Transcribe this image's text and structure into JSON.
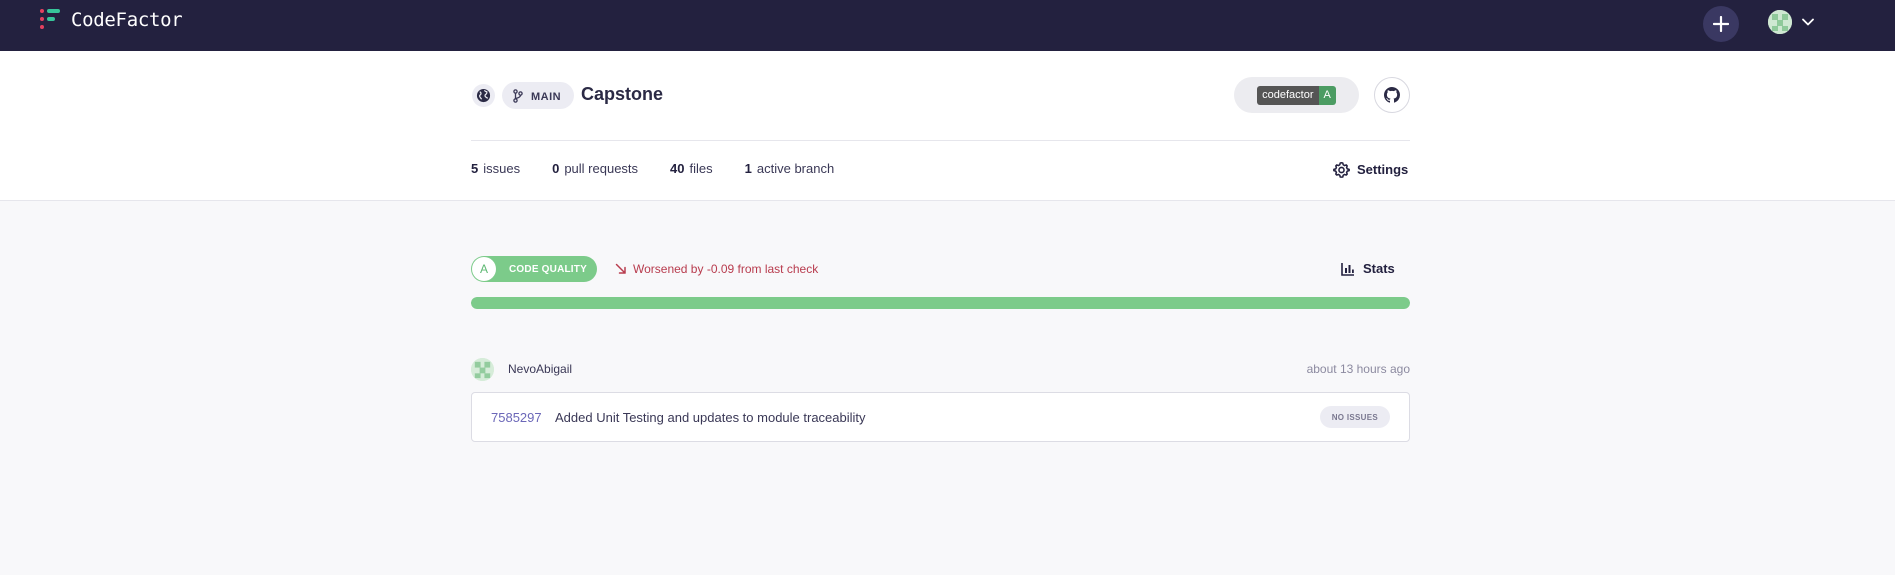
{
  "app": {
    "name": "CodeFactor"
  },
  "repo": {
    "branch": "MAIN",
    "title": "Capstone",
    "badge_label": "codefactor",
    "badge_grade": "A"
  },
  "stats": [
    {
      "count": "5",
      "label": "issues"
    },
    {
      "count": "0",
      "label": "pull requests"
    },
    {
      "count": "40",
      "label": "files"
    },
    {
      "count": "1",
      "label": "active branch"
    }
  ],
  "settings_label": "Settings",
  "quality": {
    "grade": "A",
    "label": "CODE QUALITY",
    "change_text": "Worsened by -0.09 from last check",
    "stats_label": "Stats",
    "progress_fraction": 1.0
  },
  "commit": {
    "author": "NevoAbigail",
    "time": "about 13 hours ago",
    "sha": "7585297",
    "message": "Added Unit Testing and updates to module traceability",
    "status": "NO ISSUES"
  },
  "colors": {
    "nav_bg": "#23213f",
    "quality_green": "#7ccb8a",
    "worsened_red": "#b83c4e",
    "sha_link": "#6b67b8"
  },
  "icons": [
    "codefactor-logo-icon",
    "plus-icon",
    "avatar-icon",
    "chevron-down-icon",
    "globe-icon",
    "branch-icon",
    "github-icon",
    "gear-icon",
    "trend-down-icon",
    "bar-chart-icon"
  ]
}
